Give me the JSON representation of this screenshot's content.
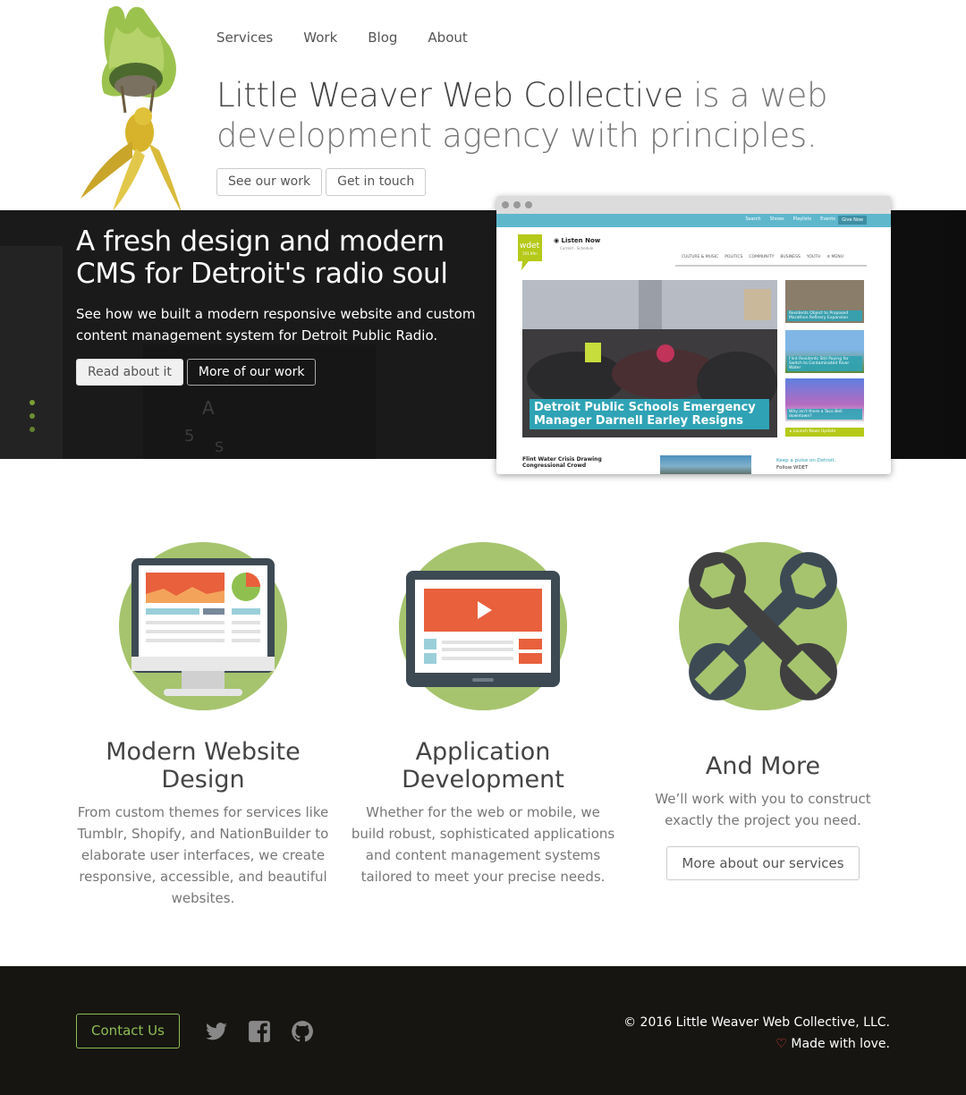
{
  "nav": {
    "items": [
      "Services",
      "Work",
      "Blog",
      "About"
    ]
  },
  "hero": {
    "name": "Little Weaver Web Collective",
    "tagline": " is a web development agency with principles.",
    "buttons": {
      "see_work": "See our work",
      "get_in_touch": "Get in touch"
    }
  },
  "feature": {
    "title": "A fresh design and modern CMS for Detroit's radio soul",
    "description": "See how we built a modern responsive website and custom content management system for Detroit Public Radio.",
    "buttons": {
      "read": "Read about it",
      "more_work": "More of our work"
    },
    "screenshot": {
      "top_nav": [
        "Search",
        "Shows",
        "Playlists",
        "Events"
      ],
      "give_now": "Give Now",
      "logo_text": "wdet",
      "logo_sub": "101.9fm",
      "listen_now": "Listen Now",
      "listen_sub": "Current · Schedule",
      "menu": [
        "CULTURE & MUSIC",
        "POLITICS",
        "COMMUNITY",
        "BUSINESS",
        "YOUTH",
        "≡ MENU"
      ],
      "main_headline": "Detroit Public Schools Emergency Manager Darnell Earley Resigns",
      "side_cards": [
        "Residents Object to Proposed Marathon Refinery Expansion",
        "Flint Residents Still Paying for Switch to Contaminated River Water",
        "Why isn't there a Taco Bell downtown?"
      ],
      "side_more": "▸ Launch News Update",
      "below_story": "Flint Water Crisis Drawing Congressional Crowd",
      "below_pulse": "Keep a pulse on Detroit.",
      "below_follow": "Follow WDET"
    }
  },
  "services": [
    {
      "title": "Modern Website Design",
      "description": "From custom themes for services like Tumblr, Shopify, and NationBuilder to elaborate user interfaces, we create responsive, accessible, and beautiful websites."
    },
    {
      "title": "Application Development",
      "description": "Whether for the web or mobile, we build robust, sophisticated applications and content management systems tailored to meet your precise needs."
    },
    {
      "title": "And More",
      "description": "We’ll work with you to construct exactly the project you need.",
      "button": "More about our services"
    }
  ],
  "footer": {
    "contact": "Contact Us",
    "social_icons": [
      "twitter-icon",
      "facebook-icon",
      "github-icon"
    ],
    "copyright": "© 2016 Little Weaver Web Collective, LLC.",
    "made_with": "Made with love.",
    "heart_icon": "heart-icon"
  },
  "colors": {
    "accent_green": "#8cbd52",
    "icon_green": "#a6c46e",
    "footer_bg": "#161511",
    "feature_bg": "#1b1b1b"
  }
}
